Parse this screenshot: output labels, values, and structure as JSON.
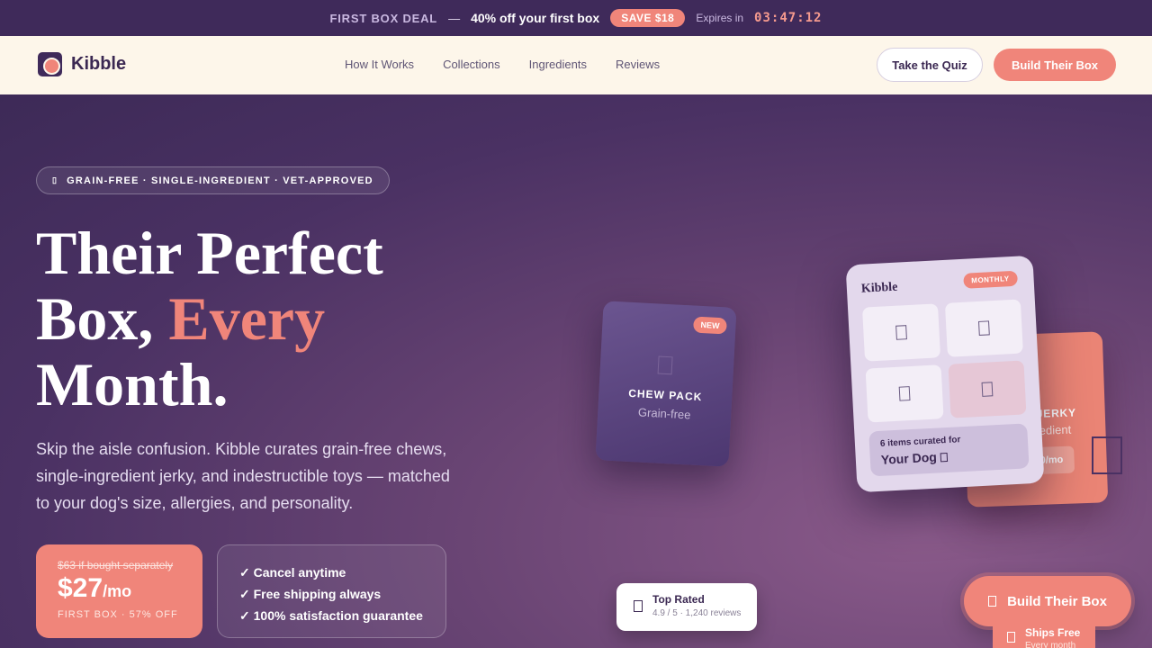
{
  "promo": {
    "deal_label": "FIRST BOX DEAL",
    "dash": "—",
    "offer": "40% off your first box",
    "save_badge": "SAVE $18",
    "expires_label": "Expires in",
    "timer": "03:47:12"
  },
  "nav": {
    "brand": "Kibble",
    "links": [
      "How It Works",
      "Collections",
      "Ingredients",
      "Reviews"
    ],
    "quiz_button": "Take the Quiz",
    "build_button": "Build Their Box"
  },
  "hero": {
    "tagline": "GRAIN-FREE · SINGLE-INGREDIENT · VET-APPROVED",
    "headline": {
      "line1": "Their Perfect",
      "line2_start": "Box, ",
      "line2_accent": "Every",
      "line3": "Month."
    },
    "subcopy": "Skip the aisle confusion. Kibble curates grain-free chews, single-ingredient jerky, and indestructible toys — matched to your dog's size, allergies, and personality.",
    "price": {
      "was": "$63 if bought separately",
      "now": "$27",
      "per": "/mo",
      "sub": "FIRST BOX · 57% OFF"
    },
    "benefits": [
      "✓ Cancel anytime",
      "✓ Free shipping always",
      "✓ 100% satisfaction guarantee"
    ]
  },
  "cards": {
    "chew": {
      "badge": "NEW",
      "title": "CHEW PACK",
      "sub": "Grain-free"
    },
    "jerky": {
      "title": "JERKY",
      "sub": "redient",
      "price": "0/mo"
    },
    "box": {
      "brand": "Kibble",
      "badge": "MONTHLY",
      "items_text": "6 items curated for",
      "for_text": "Your Dog"
    }
  },
  "rated": {
    "title": "Top Rated",
    "detail": "4.9 / 5 · 1,240 reviews"
  },
  "cta": {
    "button": "Build Their Box",
    "ships_title": "Ships Free",
    "ships_sub": "Every month"
  },
  "colors": {
    "accent": "#f0857a",
    "dark_purple": "#3f2a5a",
    "cream": "#fdf6ea"
  }
}
